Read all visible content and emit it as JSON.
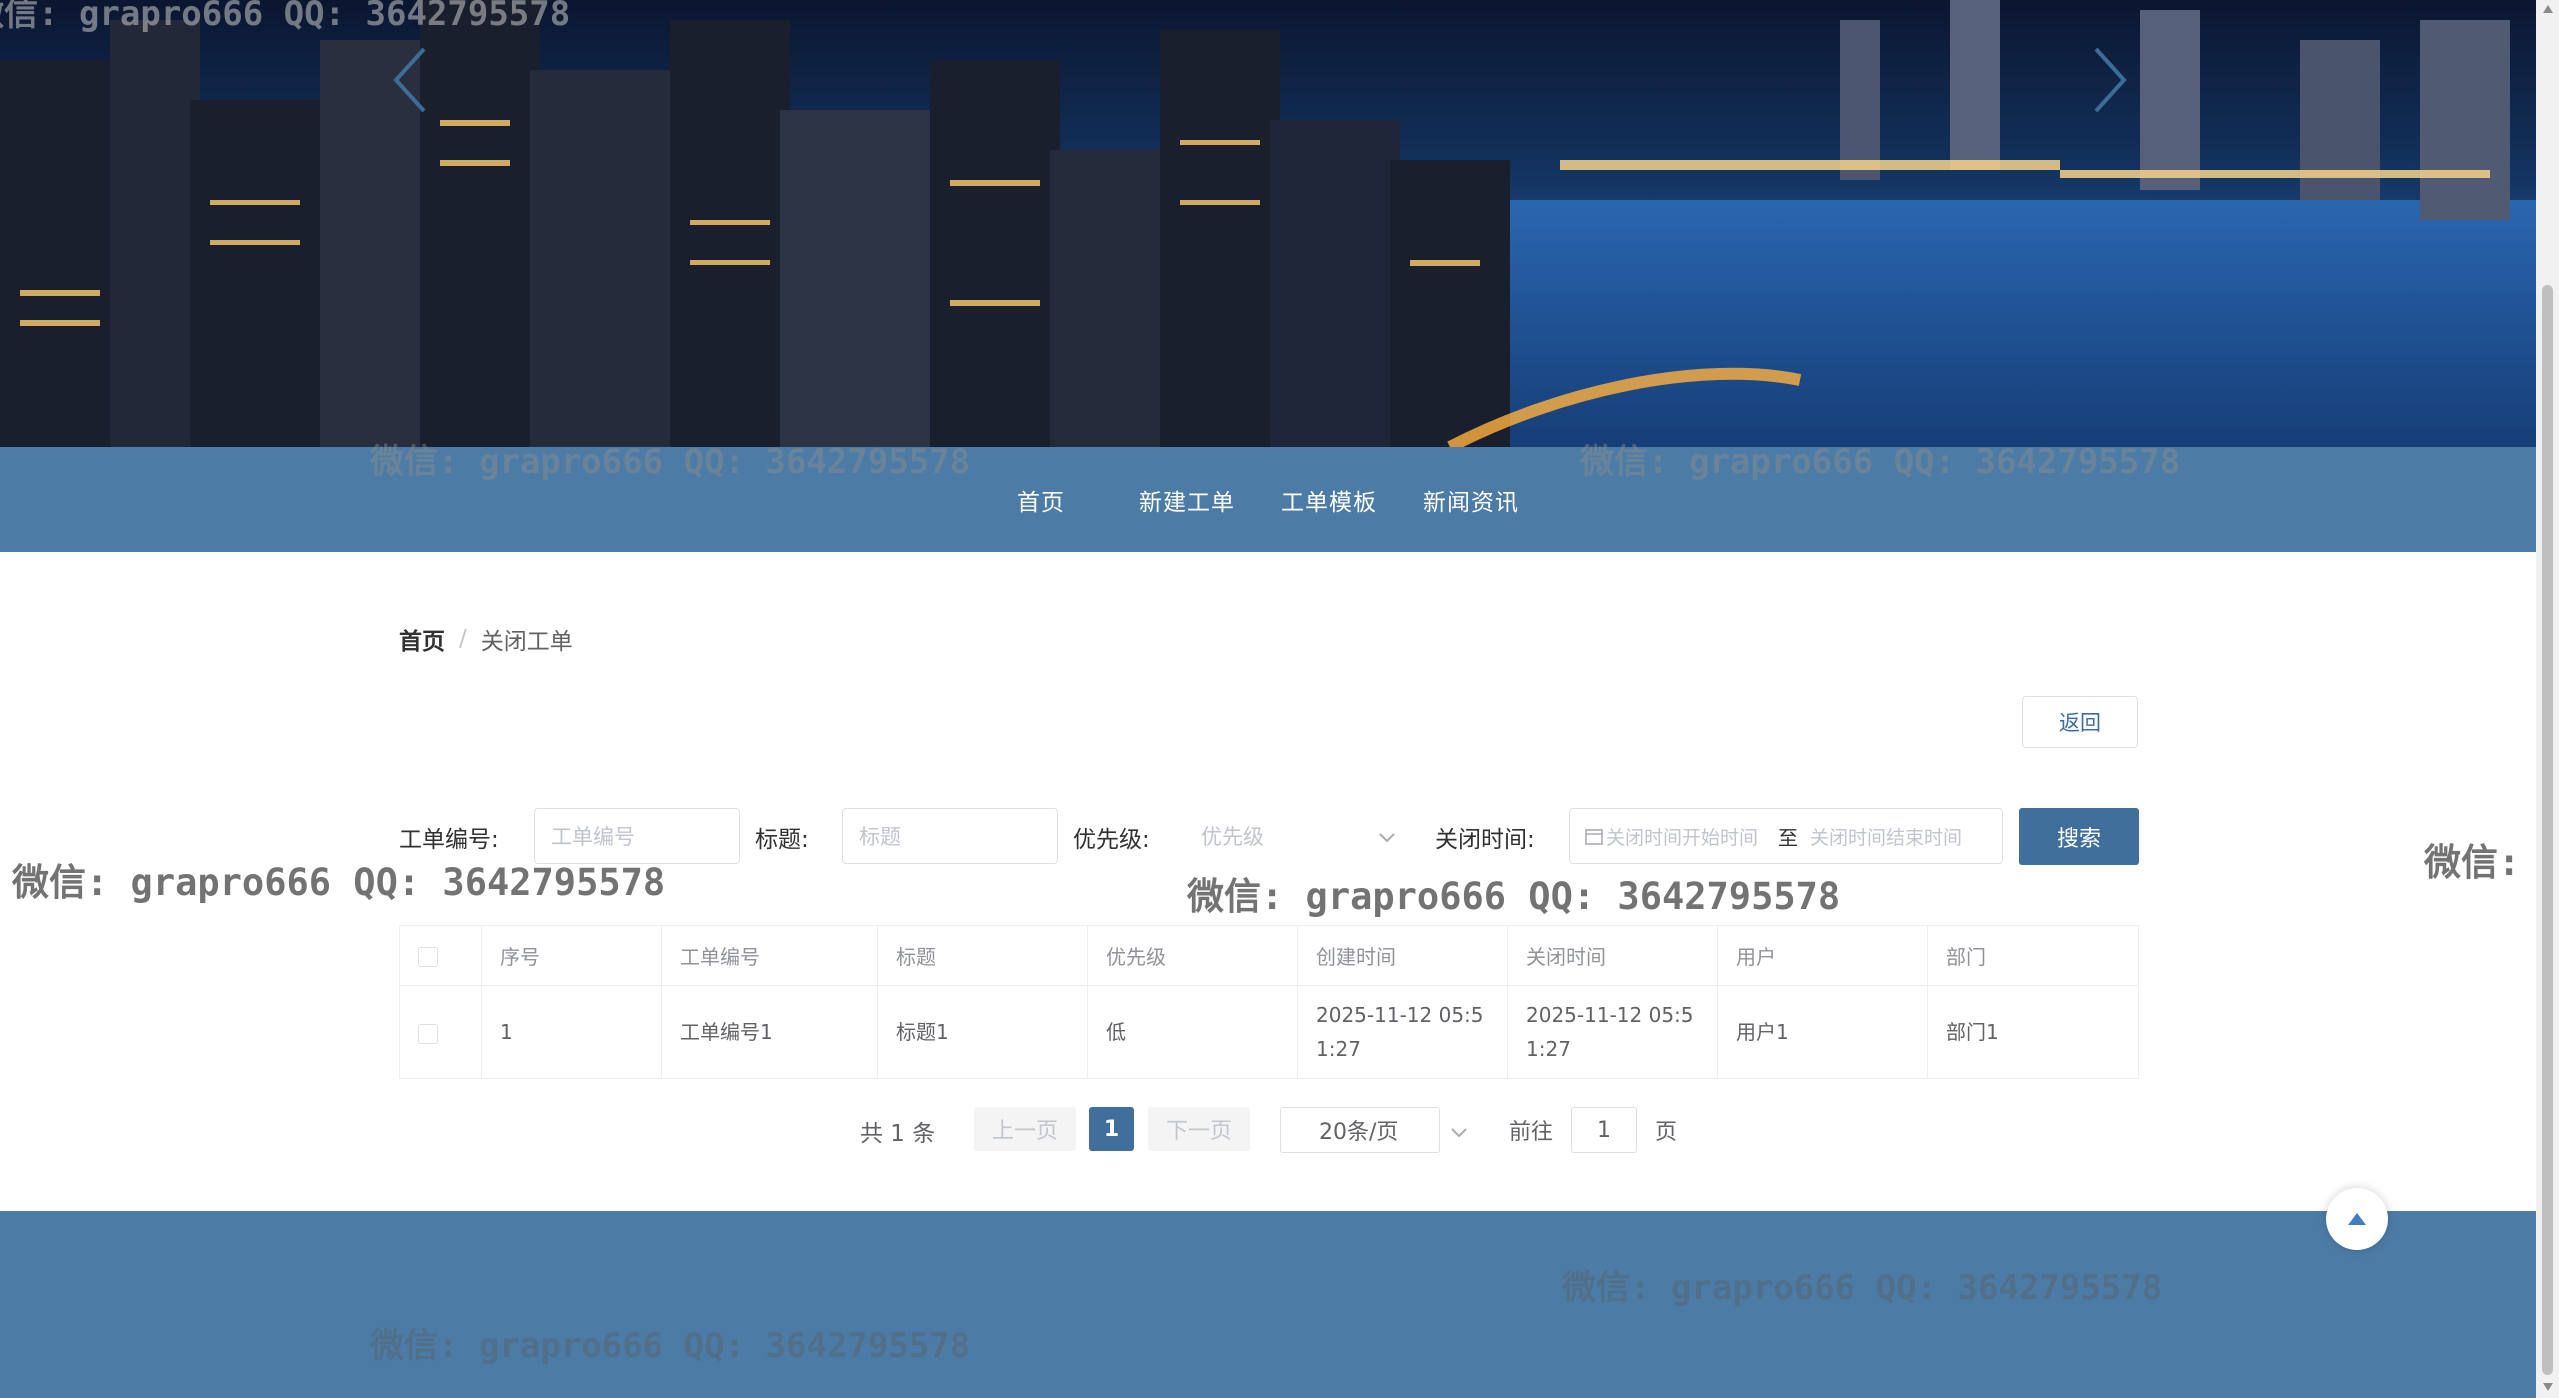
{
  "nav": {
    "items": [
      "首页",
      "新建工单",
      "工单模板",
      "新闻资讯"
    ]
  },
  "breadcrumb": {
    "home": "首页",
    "separator": "/",
    "current": "关闭工单"
  },
  "toolbar": {
    "back_label": "返回"
  },
  "filters": {
    "ticket_no_label": "工单编号:",
    "ticket_no_placeholder": "工单编号",
    "title_label": "标题:",
    "title_placeholder": "标题",
    "priority_label": "优先级:",
    "priority_placeholder": "优先级",
    "close_time_label": "关闭时间:",
    "close_start_placeholder": "关闭时间开始时间",
    "range_separator": "至",
    "close_end_placeholder": "关闭时间结束时间",
    "search_label": "搜索"
  },
  "table": {
    "headers": [
      "序号",
      "工单编号",
      "标题",
      "优先级",
      "创建时间",
      "关闭时间",
      "用户",
      "部门"
    ],
    "rows": [
      {
        "index": "1",
        "ticket_no": "工单编号1",
        "title": "标题1",
        "priority": "低",
        "created_line1": "2025-11-12 05:5",
        "created_line2": "1:27",
        "closed_line1": "2025-11-12 05:5",
        "closed_line2": "1:27",
        "user": "用户1",
        "dept": "部门1"
      }
    ]
  },
  "pagination": {
    "total": "共 1 条",
    "prev_label": "上一页",
    "current_page": "1",
    "next_label": "下一页",
    "page_size": "20条/页",
    "goto_label": "前往",
    "goto_value": "1",
    "goto_suffix": "页"
  },
  "watermark": {
    "text": "微信: grapro666 QQ: 3642795578",
    "top_left": "微信: grapro666 QQ: 3642795578",
    "right_edge": "微信:"
  },
  "colors": {
    "nav_bg": "#4c7ca6",
    "primary": "#3f6f9a",
    "footer_bg": "#4c7ca6"
  },
  "icons": {
    "carousel_prev": "chevron-left-icon",
    "carousel_next": "chevron-right-icon",
    "select_arrow": "chevron-down-icon",
    "calendar": "calendar-icon",
    "back_top": "caret-up-icon"
  }
}
